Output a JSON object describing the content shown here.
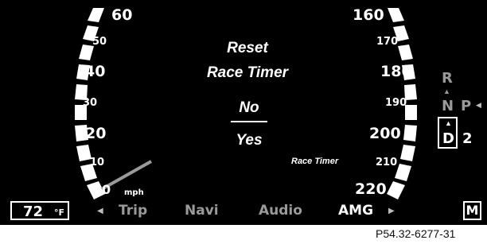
{
  "speedometer": {
    "left_labels": [
      "60",
      "50",
      "40",
      "30",
      "20",
      "10",
      "0"
    ],
    "right_labels": [
      "160",
      "170",
      "180",
      "190",
      "200",
      "210",
      "220"
    ],
    "unit": "mph"
  },
  "menu": {
    "title_line1": "Reset",
    "title_line2": "Race Timer",
    "option_no": "No",
    "option_yes": "Yes",
    "selected": "No"
  },
  "race_timer_label": "Race Timer",
  "bottom_bar": {
    "temperature_value": "72",
    "temperature_unit": "°F",
    "tabs": [
      "Trip",
      "Navi",
      "Audio",
      "AMG"
    ],
    "active_tab": "AMG",
    "mode": "M"
  },
  "transmission": {
    "gears_top": "R",
    "gear_n": "N",
    "gear_p": "P",
    "gear_d": "D",
    "current_gear": "2"
  },
  "caption": "P54.32-6277-31",
  "colors": {
    "background": "#000000",
    "foreground": "#ffffff",
    "inactive": "#9a9a9a"
  }
}
